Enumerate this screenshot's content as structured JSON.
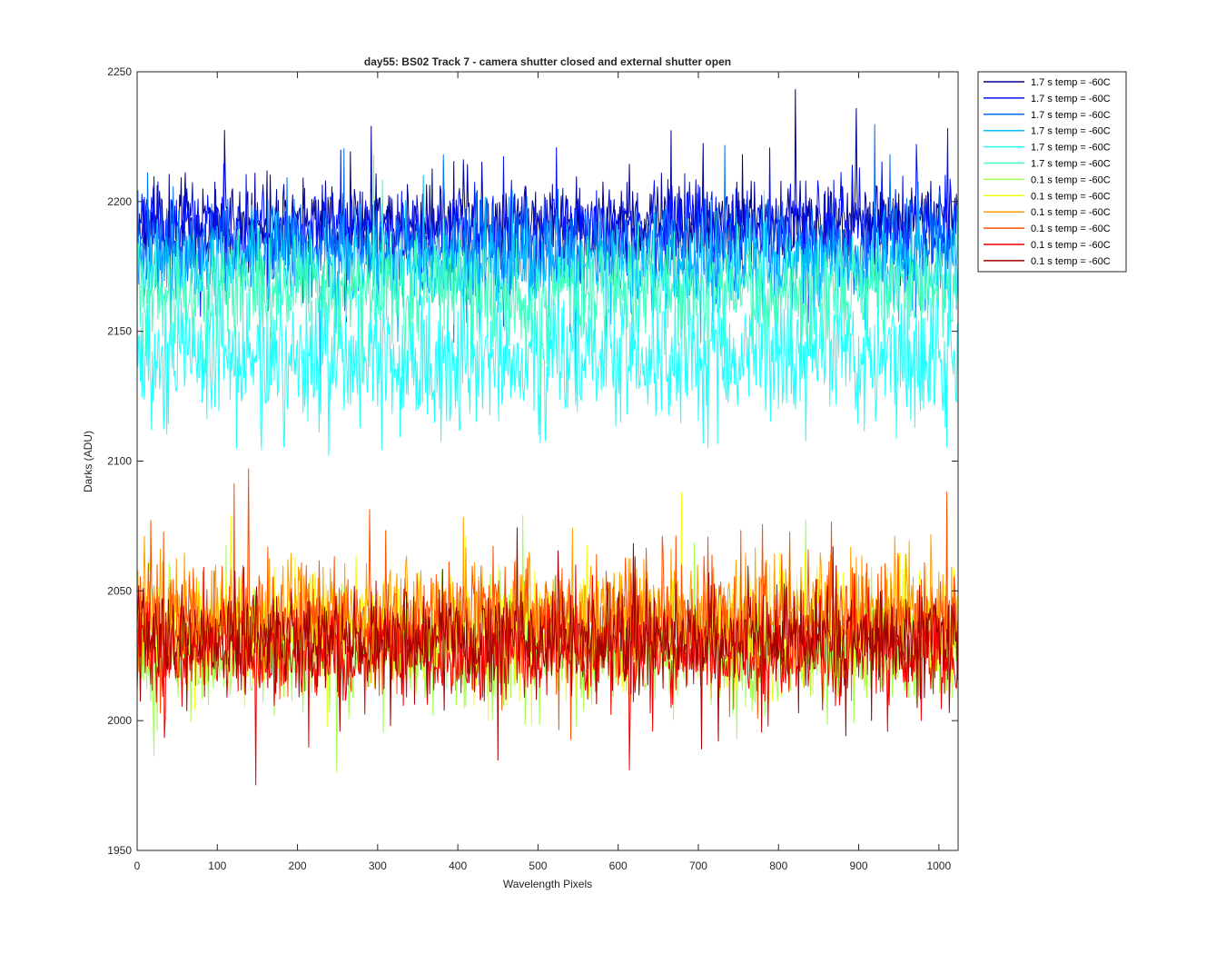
{
  "chart_data": {
    "type": "line",
    "title": "day55: BS02  Track 7 - camera shutter closed and external shutter open",
    "xlabel": "Wavelength Pixels",
    "ylabel": "Darks (ADU)",
    "xlim": [
      0,
      1024
    ],
    "ylim": [
      1950,
      2250
    ],
    "xticks": [
      0,
      100,
      200,
      300,
      400,
      500,
      600,
      700,
      800,
      900,
      1000
    ],
    "yticks": [
      1950,
      2000,
      2050,
      2100,
      2150,
      2200,
      2250
    ],
    "grid": false,
    "legend_position": "outside-top-right",
    "series": [
      {
        "name": "1.7 s temp = -60C",
        "color": "#00008F",
        "mean": 2192,
        "noise": 8,
        "seed": 11
      },
      {
        "name": "1.7 s temp = -60C",
        "color": "#0010FF",
        "mean": 2190,
        "noise": 8,
        "seed": 23
      },
      {
        "name": "1.7 s temp = -60C",
        "color": "#0070FF",
        "mean": 2182,
        "noise": 9,
        "seed": 37
      },
      {
        "name": "1.7 s temp = -60C",
        "color": "#00C0FF",
        "mean": 2175,
        "noise": 9,
        "seed": 41
      },
      {
        "name": "1.7 s temp = -60C",
        "color": "#20FFFF",
        "mean": 2140,
        "noise": 14,
        "seed": 53
      },
      {
        "name": "1.7 s temp = -60C",
        "color": "#40FFBF",
        "mean": 2165,
        "noise": 10,
        "seed": 67
      },
      {
        "name": "0.1 s temp = -60C",
        "color": "#A0FF50",
        "mean": 2025,
        "noise": 10,
        "seed": 71
      },
      {
        "name": "0.1 s temp = -60C",
        "color": "#F0FF10",
        "mean": 2035,
        "noise": 11,
        "seed": 83
      },
      {
        "name": "0.1 s temp = -60C",
        "color": "#FFA000",
        "mean": 2040,
        "noise": 11,
        "seed": 97
      },
      {
        "name": "0.1 s temp = -60C",
        "color": "#FF5000",
        "mean": 2038,
        "noise": 11,
        "seed": 101
      },
      {
        "name": "0.1 s temp = -60C",
        "color": "#F00000",
        "mean": 2025,
        "noise": 9,
        "seed": 113
      },
      {
        "name": "0.1 s temp = -60C",
        "color": "#A00000",
        "mean": 2032,
        "noise": 9,
        "seed": 127
      }
    ]
  }
}
